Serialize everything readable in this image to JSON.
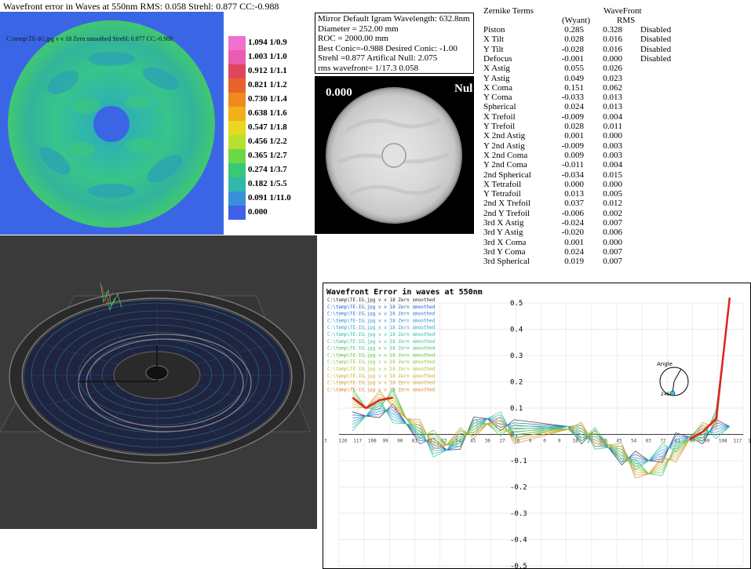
{
  "title": "Wavefront error in Waves at 550nm  RMS: 0.058 Strehl: 0.877 CC:-0.988",
  "map_caption": "C:\\temp\\TE-IG.jpg v v 18 Zern smoothed Strehl: 0.877 CC:-0.988",
  "legend": [
    {
      "label": "1.094 1/0.9",
      "color": "#f070d0"
    },
    {
      "label": "1.003 1/1.0",
      "color": "#e85db0"
    },
    {
      "label": "0.912 1/1.1",
      "color": "#e04560"
    },
    {
      "label": "0.821 1/1.2",
      "color": "#e8622a"
    },
    {
      "label": "0.730 1/1.4",
      "color": "#f08a20"
    },
    {
      "label": "0.638 1/1.6",
      "color": "#f0b018"
    },
    {
      "label": "0.547 1/1.8",
      "color": "#e8d820"
    },
    {
      "label": "0.456 1/2.2",
      "color": "#b8e030"
    },
    {
      "label": "0.365 1/2.7",
      "color": "#6cd848"
    },
    {
      "label": "0.274 1/3.7",
      "color": "#38c878"
    },
    {
      "label": "0.182 1/5.5",
      "color": "#30b8a8"
    },
    {
      "label": "0.091 1/11.0",
      "color": "#3a90d8"
    },
    {
      "label": "0.000",
      "color": "#4060e8"
    }
  ],
  "info": [
    "Mirror Default Igram Wavelength: 632.8nm",
    "Diameter = 252.00 mm",
    "ROC = 2000.00 mm",
    "Best Conic=-0.988 Desired Conic: -1.00",
    " Strehl =0.877  Artifical Null:  2.075",
    "rms wavefront= 1/17.3  0.058"
  ],
  "igram_label": "0.000",
  "null_label": "Nul",
  "zernike": {
    "header_terms": "Zernike Terms",
    "header_wavefront": "WaveFront",
    "header_wyant": "(Wyant)",
    "header_rms": "RMS",
    "rows": [
      {
        "name": "Piston",
        "wyant": "0.285",
        "rms": "0.328",
        "status": "Disabled"
      },
      {
        "name": "X Tilt",
        "wyant": "0.028",
        "rms": "0.016",
        "status": "Disabled"
      },
      {
        "name": "Y Tilt",
        "wyant": "-0.028",
        "rms": "0.016",
        "status": "Disabled"
      },
      {
        "name": "Defocus",
        "wyant": "-0.001",
        "rms": "0.000",
        "status": "Disabled"
      },
      {
        "name": "X Astig",
        "wyant": "0.055",
        "rms": "0.026",
        "status": ""
      },
      {
        "name": "Y Astig",
        "wyant": "0.049",
        "rms": "0.023",
        "status": ""
      },
      {
        "name": "X Coma",
        "wyant": "0.151",
        "rms": "0.062",
        "status": ""
      },
      {
        "name": "Y Coma",
        "wyant": "-0.033",
        "rms": "0.013",
        "status": ""
      },
      {
        "name": "Spherical",
        "wyant": "0.024",
        "rms": "0.013",
        "status": ""
      },
      {
        "name": "X Trefoil",
        "wyant": "-0.009",
        "rms": "0.004",
        "status": ""
      },
      {
        "name": "Y Trefoil",
        "wyant": "0.028",
        "rms": "0.011",
        "status": ""
      },
      {
        "name": "X 2nd Astig",
        "wyant": "0.001",
        "rms": "0.000",
        "status": ""
      },
      {
        "name": "Y 2nd Astig",
        "wyant": "-0.009",
        "rms": "0.003",
        "status": ""
      },
      {
        "name": "X 2nd Coma",
        "wyant": "0.009",
        "rms": "0.003",
        "status": ""
      },
      {
        "name": "Y 2nd Coma",
        "wyant": "-0.011",
        "rms": "0.004",
        "status": ""
      },
      {
        "name": "2nd Spherical",
        "wyant": "-0.034",
        "rms": "0.015",
        "status": ""
      },
      {
        "name": "X Tetrafoil",
        "wyant": "0.000",
        "rms": "0.000",
        "status": ""
      },
      {
        "name": "Y Tetrafoil",
        "wyant": "0.013",
        "rms": "0.005",
        "status": ""
      },
      {
        "name": "2nd X Trefoil",
        "wyant": "0.037",
        "rms": "0.012",
        "status": ""
      },
      {
        "name": "2nd Y Trefoil",
        "wyant": "-0.006",
        "rms": "0.002",
        "status": ""
      },
      {
        "name": "3rd X Astig",
        "wyant": "-0.024",
        "rms": "0.007",
        "status": ""
      },
      {
        "name": "3rd Y Astig",
        "wyant": "-0.020",
        "rms": "0.006",
        "status": ""
      },
      {
        "name": "3rd X Coma",
        "wyant": "0.001",
        "rms": "0.000",
        "status": ""
      },
      {
        "name": "3rd Y Coma",
        "wyant": "0.024",
        "rms": "0.007",
        "status": ""
      },
      {
        "name": "3rd Spherical",
        "wyant": "0.019",
        "rms": "0.007",
        "status": ""
      }
    ]
  },
  "profile": {
    "title": "Wavefront Error in waves at 550nm",
    "series_label": "C:\\temp\\TE-IG.jpg v v 18 Zern smoothed",
    "series_colors": [
      "#2a2a2a",
      "#2060c0",
      "#2878d8",
      "#3090d0",
      "#30a8c8",
      "#30b8b0",
      "#38c090",
      "#40c070",
      "#60c848",
      "#88c838",
      "#b0c030",
      "#c8b030",
      "#d8a030",
      "#d08a30"
    ],
    "angle_label": "Angle",
    "angle_value": "246",
    "y_ticks": [
      "0.5",
      "0.4",
      "0.3",
      "0.2",
      "0.1",
      "0.",
      "-0.1",
      "-0.2",
      "-0.3",
      "-0.4",
      "-0.5"
    ],
    "x_ticks": [
      "3",
      "126",
      "117",
      "108",
      "99",
      "90",
      "81",
      "72",
      "63",
      "54",
      "45",
      "36",
      "27",
      "18",
      "9",
      "0",
      "9",
      "18",
      "27",
      "36",
      "45",
      "54",
      "63",
      "72",
      "81",
      "90",
      "99",
      "108",
      "117",
      "126"
    ]
  },
  "chart_data": {
    "type": "line",
    "title": "Wavefront Error in waves at 550nm",
    "xlabel": "",
    "ylabel": "",
    "ylim": [
      -0.5,
      0.5
    ],
    "x": [
      -126,
      -117,
      -108,
      -99,
      -90,
      -81,
      -72,
      -63,
      -54,
      -45,
      -36,
      -27,
      -18,
      18,
      27,
      36,
      45,
      54,
      63,
      72,
      81,
      90,
      99,
      108,
      117,
      126
    ],
    "grid": true,
    "series": [
      {
        "name": "C:\\temp\\TE-IG.jpg v v 18 Zern smoothed",
        "values": [
          0.05,
          0.07,
          0.1,
          0.08,
          0.04,
          0.0,
          -0.05,
          -0.06,
          -0.02,
          0.03,
          0.06,
          0.05,
          0.02,
          0.03,
          0.0,
          -0.02,
          -0.05,
          -0.08,
          -0.1,
          -0.1,
          -0.07,
          -0.03,
          -0.01,
          0.0,
          0.02,
          0.03
        ]
      },
      {
        "name": "C:\\temp\\TE-IG.jpg v v 18 Zern smoothed",
        "values": [
          0.14,
          0.1,
          0.13,
          0.14,
          0.06,
          0.02,
          -0.02,
          -0.04,
          -0.01,
          0.02,
          0.04,
          0.03,
          0.0,
          0.02,
          0.01,
          -0.01,
          -0.04,
          -0.07,
          -0.13,
          -0.15,
          -0.12,
          -0.07,
          -0.02,
          0.01,
          0.06,
          0.52
        ]
      }
    ]
  }
}
